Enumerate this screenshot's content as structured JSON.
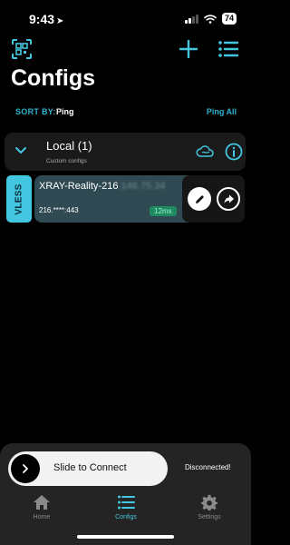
{
  "status_bar": {
    "time": "9:43",
    "battery": "74"
  },
  "page": {
    "title": "Configs"
  },
  "sort": {
    "label": "SORT BY:",
    "value": "Ping",
    "ping_all": "Ping All"
  },
  "group": {
    "title": "Local (1)",
    "subtitle": "Custom configs"
  },
  "config": {
    "protocol": "VLESS",
    "name": "XRAY-Reality-216",
    "name_obscured": ".146.75.34",
    "address": "216.****:443",
    "latency": "12ms"
  },
  "connect": {
    "slider_label": "Slide to Connect",
    "status": "Disconnected!"
  },
  "tabs": [
    {
      "label": "Home",
      "icon": "home-icon"
    },
    {
      "label": "Configs",
      "icon": "list-icon"
    },
    {
      "label": "Settings",
      "icon": "gear-icon"
    }
  ],
  "active_tab": "Configs",
  "colors": {
    "accent": "#43c7e0",
    "card": "#2f4a52",
    "latency": "#1f8a62",
    "background": "#000000"
  }
}
